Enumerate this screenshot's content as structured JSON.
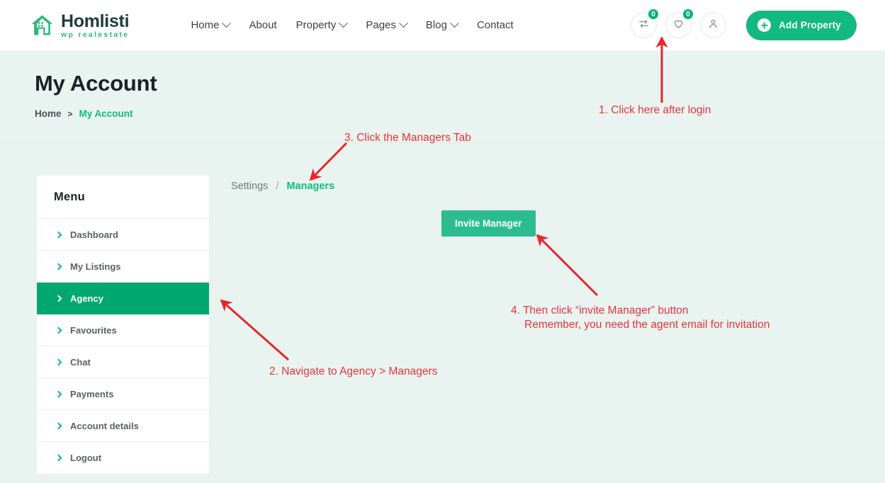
{
  "header": {
    "logo": {
      "title": "Homlisti",
      "subtitle": "wp realestate",
      "icon": "house-icon"
    },
    "nav": [
      {
        "label": "Home",
        "has_dropdown": true
      },
      {
        "label": "About",
        "has_dropdown": false
      },
      {
        "label": "Property",
        "has_dropdown": true
      },
      {
        "label": "Pages",
        "has_dropdown": true
      },
      {
        "label": "Blog",
        "has_dropdown": true
      },
      {
        "label": "Contact",
        "has_dropdown": false
      }
    ],
    "actions": {
      "compare": {
        "icon": "compare-arrows-icon",
        "badge": "0"
      },
      "wishlist": {
        "icon": "heart-icon",
        "badge": "0"
      },
      "account": {
        "icon": "user-icon"
      },
      "add_property": {
        "label": "Add Property",
        "icon": "plus-circle-icon"
      }
    }
  },
  "page": {
    "title": "My Account",
    "breadcrumb": {
      "home": "Home",
      "separator": ">",
      "current": "My Account"
    }
  },
  "sidebar": {
    "heading": "Menu",
    "items": [
      {
        "label": "Dashboard",
        "active": false
      },
      {
        "label": "My Listings",
        "active": false
      },
      {
        "label": "Agency",
        "active": true
      },
      {
        "label": "Favourites",
        "active": false
      },
      {
        "label": "Chat",
        "active": false
      },
      {
        "label": "Payments",
        "active": false
      },
      {
        "label": "Account details",
        "active": false
      },
      {
        "label": "Logout",
        "active": false
      }
    ]
  },
  "main": {
    "tabs": [
      {
        "label": "Settings",
        "active": false
      },
      {
        "label": "Managers",
        "active": true
      }
    ],
    "tab_separator": "/",
    "invite_button": "Invite Manager"
  },
  "annotations": [
    {
      "id": "step-1",
      "text": "1. Click here after login"
    },
    {
      "id": "step-2",
      "text": "2. Navigate to Agency > Managers"
    },
    {
      "id": "step-3",
      "text": "3. Click the Managers Tab"
    },
    {
      "id": "step-4-line1",
      "text": "4. Then click “invite Manager” button"
    },
    {
      "id": "step-4-line2",
      "text": "Remember, you need the agent email for invitation"
    }
  ],
  "colors": {
    "brand_green": "#12b981",
    "active_green": "#00a86f",
    "annotation_red": "#e8333a",
    "page_background": "#e9f4f1",
    "header_background": "#ffffff"
  }
}
